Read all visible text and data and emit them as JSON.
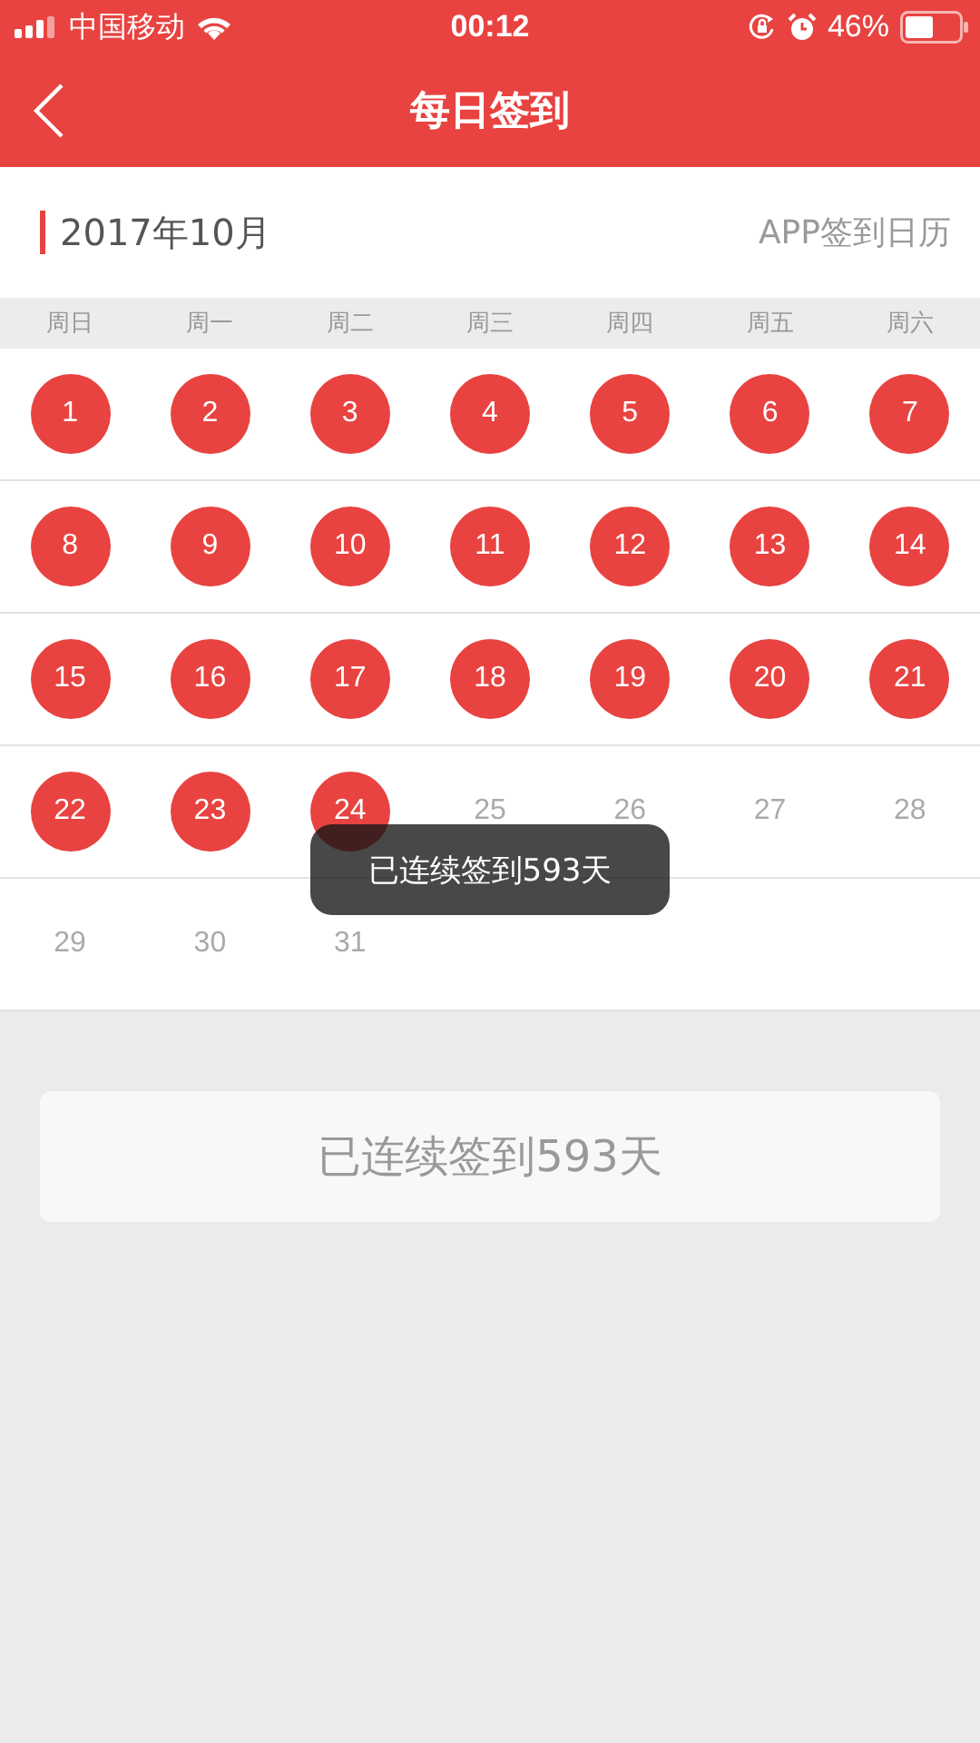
{
  "status_bar": {
    "carrier": "中国移动",
    "time": "00:12",
    "battery": "46%"
  },
  "nav_bar": {
    "title": "每日签到"
  },
  "month_bar": {
    "month": "2017年10月",
    "link": "APP签到日历"
  },
  "weekdays": [
    "周日",
    "周一",
    "周二",
    "周三",
    "周四",
    "周五",
    "周六"
  ],
  "weeks": [
    [
      {
        "day": "1",
        "signed": true
      },
      {
        "day": "2",
        "signed": true
      },
      {
        "day": "3",
        "signed": true
      },
      {
        "day": "4",
        "signed": true
      },
      {
        "day": "5",
        "signed": true
      },
      {
        "day": "6",
        "signed": true
      },
      {
        "day": "7",
        "signed": true
      }
    ],
    [
      {
        "day": "8",
        "signed": true
      },
      {
        "day": "9",
        "signed": true
      },
      {
        "day": "10",
        "signed": true
      },
      {
        "day": "11",
        "signed": true
      },
      {
        "day": "12",
        "signed": true
      },
      {
        "day": "13",
        "signed": true
      },
      {
        "day": "14",
        "signed": true
      }
    ],
    [
      {
        "day": "15",
        "signed": true
      },
      {
        "day": "16",
        "signed": true
      },
      {
        "day": "17",
        "signed": true
      },
      {
        "day": "18",
        "signed": true
      },
      {
        "day": "19",
        "signed": true
      },
      {
        "day": "20",
        "signed": true
      },
      {
        "day": "21",
        "signed": true
      }
    ],
    [
      {
        "day": "22",
        "signed": true
      },
      {
        "day": "23",
        "signed": true
      },
      {
        "day": "24",
        "signed": true
      },
      {
        "day": "25",
        "signed": false
      },
      {
        "day": "26",
        "signed": false
      },
      {
        "day": "27",
        "signed": false
      },
      {
        "day": "28",
        "signed": false
      }
    ],
    [
      {
        "day": "29",
        "signed": false
      },
      {
        "day": "30",
        "signed": false
      },
      {
        "day": "31",
        "signed": false
      }
    ]
  ],
  "toast": "已连续签到593天",
  "streak_button": "已连续签到593天"
}
